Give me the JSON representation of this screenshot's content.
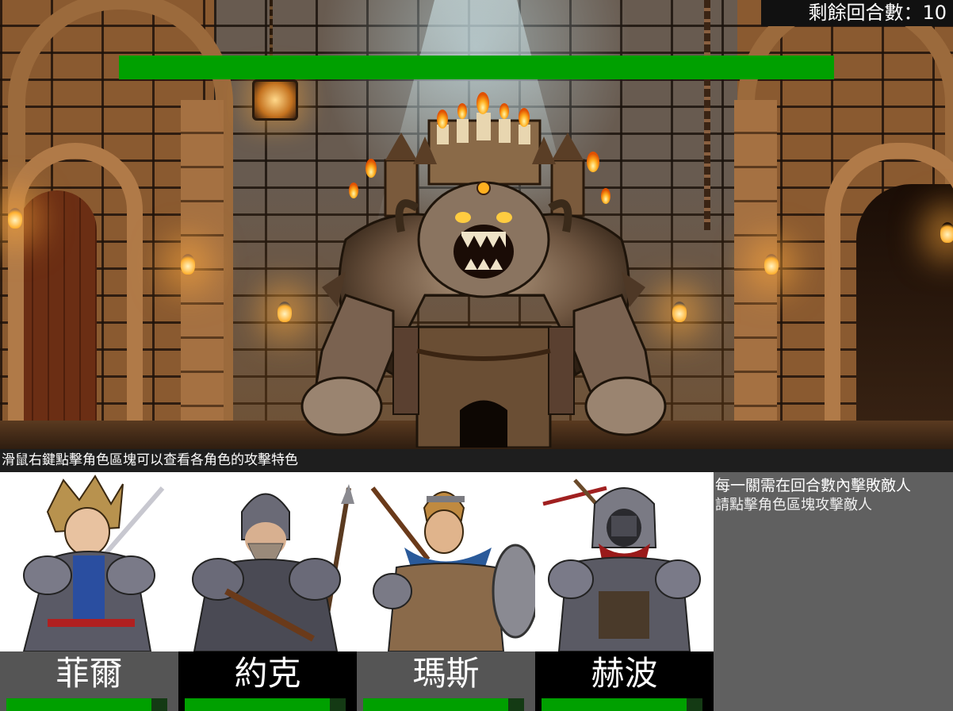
{
  "hud": {
    "turns_label": "剩餘回合數：10",
    "boss_hp_fraction": 1.0
  },
  "hint": "滑鼠右鍵點擊角色區塊可以查看各角色的攻擊特色",
  "party": [
    {
      "name": "菲爾",
      "name_bg": "#555555",
      "hp_fraction": 0.9
    },
    {
      "name": "約克",
      "name_bg": "#000000",
      "hp_fraction": 0.9
    },
    {
      "name": "瑪斯",
      "name_bg": "#555555",
      "hp_fraction": 0.9
    },
    {
      "name": "赫波",
      "name_bg": "#000000",
      "hp_fraction": 0.9
    }
  ],
  "info": {
    "line1": "每一關需在回合數內擊敗敵人",
    "line2": "請點擊角色區塊攻擊敵人"
  },
  "colors": {
    "hp_green": "#00a000",
    "info_panel": "#606060"
  }
}
